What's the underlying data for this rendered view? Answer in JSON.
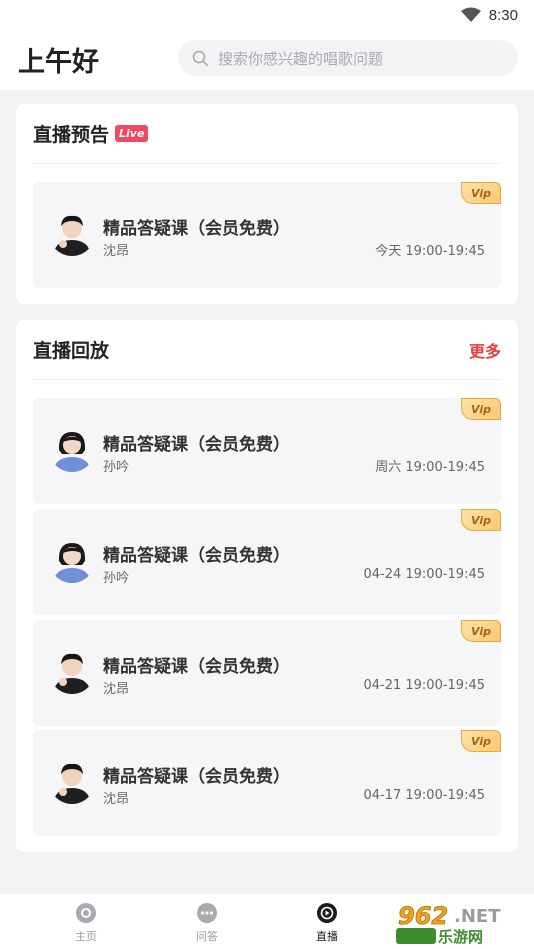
{
  "status_bar": {
    "time": "8:30"
  },
  "header": {
    "greeting": "上午好",
    "search_placeholder": "搜索你感兴趣的唱歌问题"
  },
  "preview": {
    "title": "直播预告",
    "badge": "Live",
    "items": [
      {
        "title": "精品答疑课（会员免费）",
        "teacher": "沈昂",
        "time": "今天 19:00-19:45",
        "vip": "Vip"
      }
    ]
  },
  "replay": {
    "title": "直播回放",
    "more": "更多",
    "items": [
      {
        "title": "精品答疑课（会员免费）",
        "teacher": "孙吟",
        "time": "周六 19:00-19:45",
        "vip": "Vip"
      },
      {
        "title": "精品答疑课（会员免费）",
        "teacher": "孙吟",
        "time": "04-24 19:00-19:45",
        "vip": "Vip"
      },
      {
        "title": "精品答疑课（会员免费）",
        "teacher": "沈昂",
        "time": "04-21 19:00-19:45",
        "vip": "Vip"
      },
      {
        "title": "精品答疑课（会员免费）",
        "teacher": "沈昂",
        "time": "04-17 19:00-19:45",
        "vip": "Vip"
      }
    ]
  },
  "tabbar": {
    "tabs": [
      {
        "label": "主页",
        "icon": "home-icon"
      },
      {
        "label": "问答",
        "icon": "chat-icon"
      },
      {
        "label": "直播",
        "icon": "live-play-icon"
      }
    ],
    "active": "直播"
  },
  "watermark": {
    "text": "962.NET",
    "subtext": "乐游网"
  },
  "colors": {
    "accent_red": "#ef3b3b",
    "live_badge": "#ef4a5d",
    "vip_gold": "#f8c870"
  }
}
